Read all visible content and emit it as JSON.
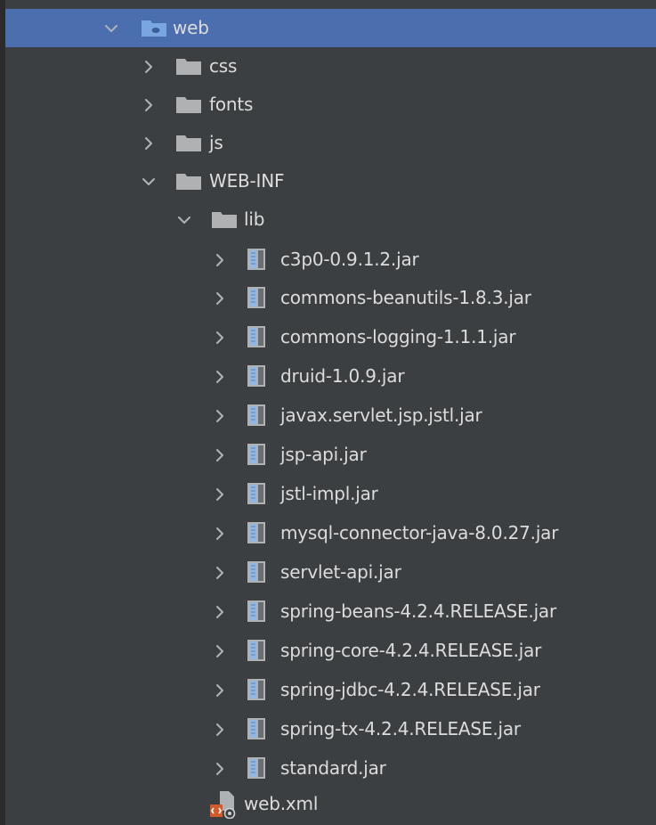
{
  "colors": {
    "background": "#3c3f41",
    "selection": "#4b6eaf",
    "text": "#dcdcdc",
    "folder": "#afb1b3",
    "web_folder": "#79a6e0",
    "jar_blue": "#8fb8e6"
  },
  "tree": {
    "web": {
      "label": "web",
      "expanded": true,
      "icon": "web-folder-icon"
    },
    "css": {
      "label": "css",
      "expanded": false,
      "icon": "folder-icon"
    },
    "fonts": {
      "label": "fonts",
      "expanded": false,
      "icon": "folder-icon"
    },
    "js": {
      "label": "js",
      "expanded": false,
      "icon": "folder-icon"
    },
    "web_inf": {
      "label": "WEB-INF",
      "expanded": true,
      "icon": "folder-icon"
    },
    "lib": {
      "label": "lib",
      "expanded": true,
      "icon": "folder-icon"
    },
    "jars": [
      {
        "label": "c3p0-0.9.1.2.jar"
      },
      {
        "label": "commons-beanutils-1.8.3.jar"
      },
      {
        "label": "commons-logging-1.1.1.jar"
      },
      {
        "label": "druid-1.0.9.jar"
      },
      {
        "label": "javax.servlet.jsp.jstl.jar"
      },
      {
        "label": "jsp-api.jar"
      },
      {
        "label": "jstl-impl.jar"
      },
      {
        "label": "mysql-connector-java-8.0.27.jar"
      },
      {
        "label": "servlet-api.jar"
      },
      {
        "label": "spring-beans-4.2.4.RELEASE.jar"
      },
      {
        "label": "spring-core-4.2.4.RELEASE.jar"
      },
      {
        "label": "spring-jdbc-4.2.4.RELEASE.jar"
      },
      {
        "label": "spring-tx-4.2.4.RELEASE.jar"
      },
      {
        "label": "standard.jar"
      }
    ],
    "web_xml": {
      "label": "web.xml",
      "icon": "web-xml-file-icon"
    }
  }
}
